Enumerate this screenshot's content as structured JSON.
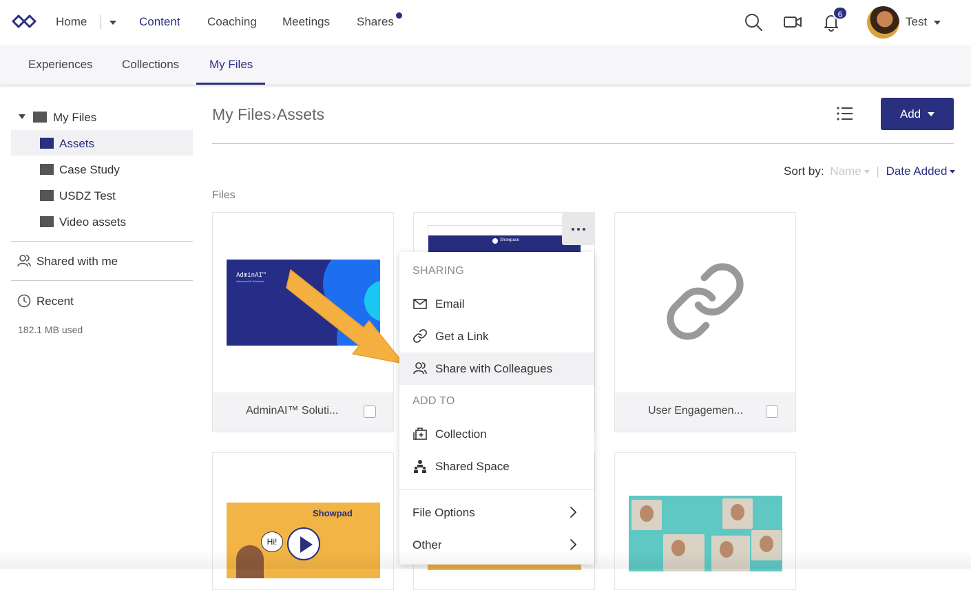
{
  "nav": {
    "items": [
      "Home",
      "Content",
      "Coaching",
      "Meetings",
      "Shares"
    ],
    "active": "Content",
    "notification_count": "6",
    "user_name": "Test"
  },
  "subnav": {
    "tabs": [
      "Experiences",
      "Collections",
      "My Files"
    ],
    "active": "My Files"
  },
  "sidebar": {
    "root": "My Files",
    "folders": [
      "Assets",
      "Case Study",
      "USDZ Test",
      "Video assets"
    ],
    "active_folder": "Assets",
    "shared": "Shared with me",
    "recent": "Recent",
    "storage_used": "182.1 MB used"
  },
  "main": {
    "breadcrumb_root": "My Files",
    "breadcrumb_sep": "›",
    "breadcrumb_current": "Assets",
    "add_label": "Add",
    "sort": {
      "label": "Sort by:",
      "name": "Name",
      "separator": "|",
      "date": "Date Added"
    },
    "files_label": "Files",
    "cards": [
      {
        "title": "AdminAI™ Soluti...",
        "thumb_title": "AdminAI™",
        "thumb_subtitle": "Advanced AI Solutions"
      },
      {
        "title": "",
        "thumb_brand": "Showpace"
      },
      {
        "title": "User Engagemen..."
      },
      {
        "thumb_brand": "Showpad",
        "thumb_bubble": "Hi!"
      },
      {},
      {}
    ]
  },
  "menu": {
    "section_sharing": "SHARING",
    "email": "Email",
    "get_link": "Get a Link",
    "share_colleagues": "Share with Colleagues",
    "section_add": "ADD TO",
    "collection": "Collection",
    "shared_space": "Shared Space",
    "file_options": "File Options",
    "other": "Other"
  },
  "colors": {
    "accent": "#2b2f80",
    "arrow": "#f5b041",
    "menu_hover": "#f1f1f4"
  }
}
